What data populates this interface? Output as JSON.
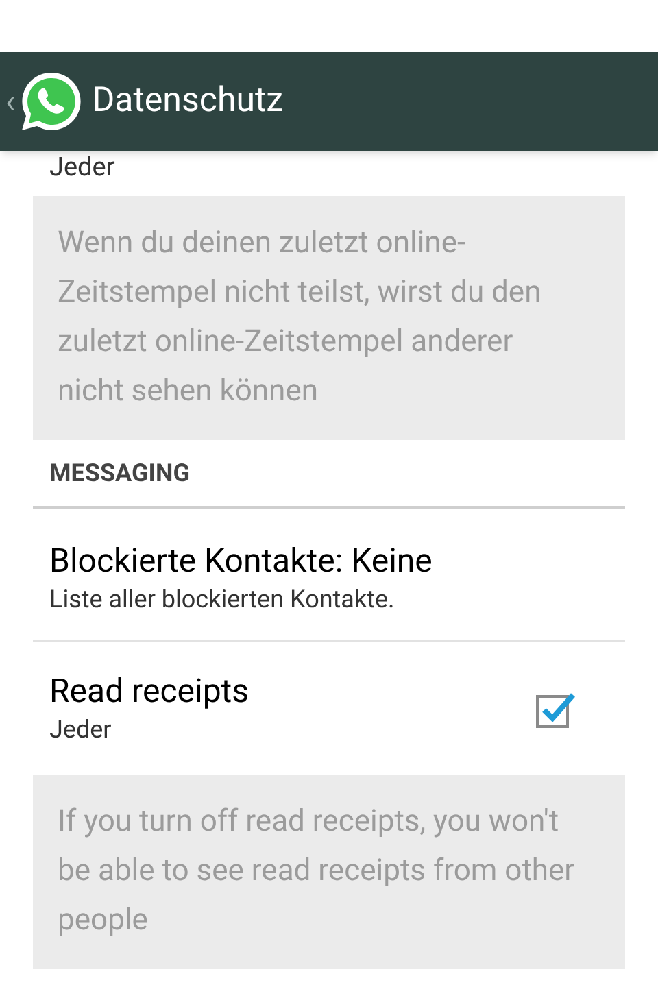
{
  "action_bar": {
    "back": "‹",
    "title": "Datenschutz"
  },
  "sections": [
    {
      "kind": "partial",
      "summary": "Jeder",
      "note": "Wenn du deinen zuletzt online-Zeitstempel nicht teilst, wirst du den zuletzt online-Zeitstempel anderer nicht sehen können"
    },
    {
      "kind": "header",
      "title": "MESSAGING"
    },
    {
      "kind": "row",
      "title": "Blockierte Kontakte: Keine",
      "summary": "Liste aller blockierten Kontakte."
    },
    {
      "kind": "check",
      "title": "Read receipts",
      "summary": "Jeder",
      "checked": true,
      "note": "If you turn off read receipts, you won't be able to see read receipts from other people"
    }
  ]
}
